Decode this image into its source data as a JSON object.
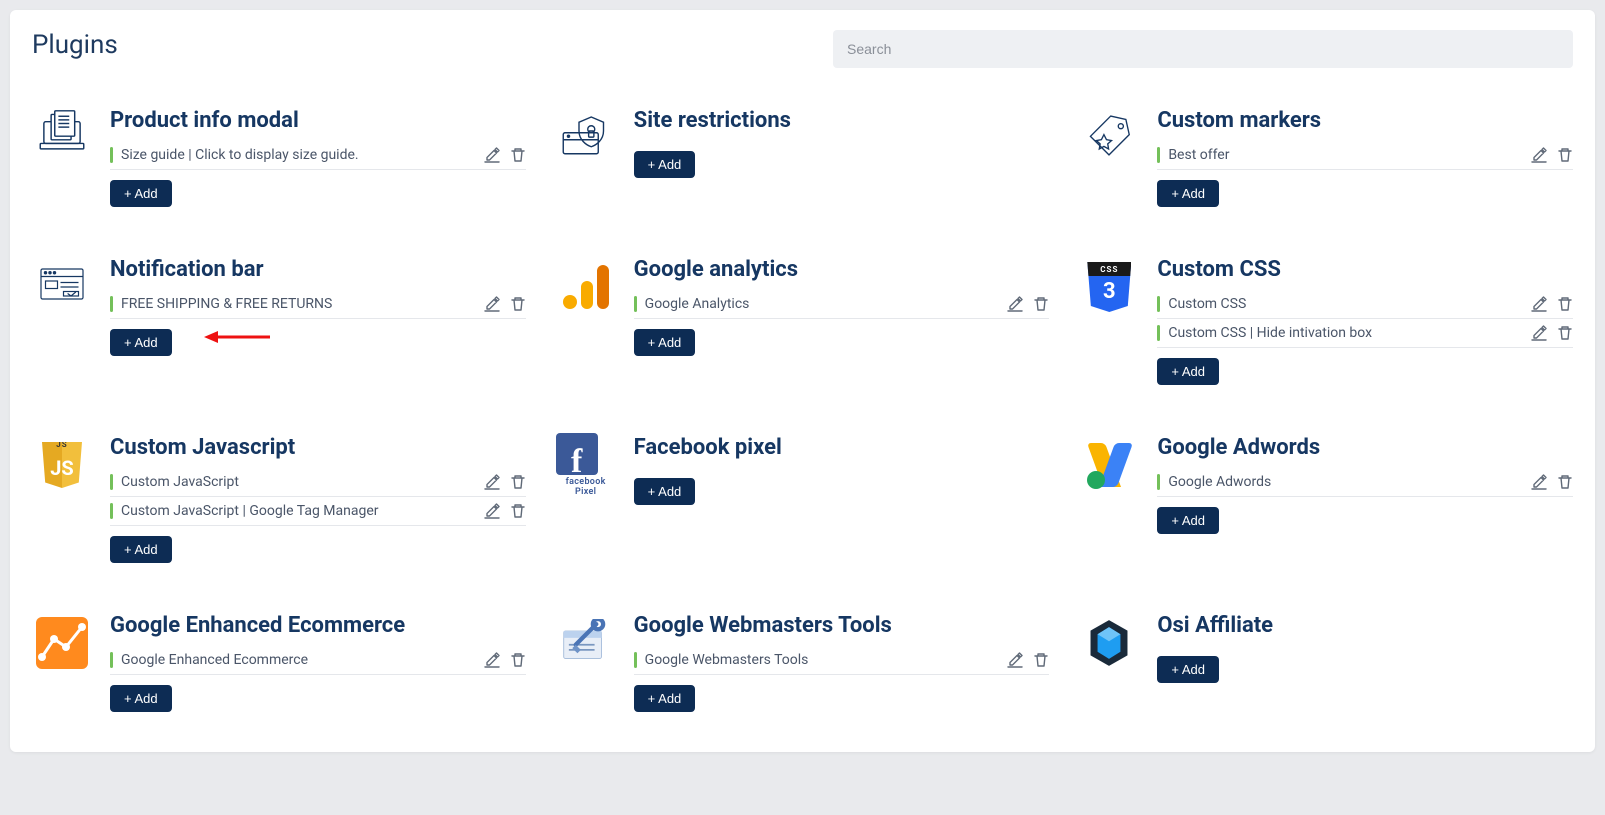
{
  "page": {
    "title": "Plugins"
  },
  "search": {
    "placeholder": "Search"
  },
  "add_label": "+ Add",
  "plugins": [
    {
      "key": "product-info-modal",
      "title": "Product info modal",
      "icon": "laptop-docs",
      "items": [
        {
          "label": "Size guide | Click to display size guide."
        }
      ],
      "show_arrow": false
    },
    {
      "key": "site-restrictions",
      "title": "Site restrictions",
      "icon": "shield-lock",
      "items": [],
      "show_arrow": false
    },
    {
      "key": "custom-markers",
      "title": "Custom markers",
      "icon": "tag-star",
      "items": [
        {
          "label": "Best offer"
        }
      ],
      "show_arrow": false
    },
    {
      "key": "notification-bar",
      "title": "Notification bar",
      "icon": "browser-bar",
      "items": [
        {
          "label": "FREE SHIPPING & FREE RETURNS"
        }
      ],
      "show_arrow": true
    },
    {
      "key": "google-analytics",
      "title": "Google analytics",
      "icon": "ga",
      "items": [
        {
          "label": "Google Analytics"
        }
      ],
      "show_arrow": false
    },
    {
      "key": "custom-css",
      "title": "Custom CSS",
      "icon": "css",
      "items": [
        {
          "label": "Custom CSS"
        },
        {
          "label": "Custom CSS | Hide intivation box"
        }
      ],
      "show_arrow": false
    },
    {
      "key": "custom-javascript",
      "title": "Custom Javascript",
      "icon": "js",
      "items": [
        {
          "label": "Custom JavaScript"
        },
        {
          "label": "Custom JavaScript | Google Tag Manager"
        }
      ],
      "show_arrow": false
    },
    {
      "key": "facebook-pixel",
      "title": "Facebook pixel",
      "icon": "fb",
      "items": [],
      "show_arrow": false,
      "sub": "facebook Pixel"
    },
    {
      "key": "google-adwords",
      "title": "Google Adwords",
      "icon": "adwords",
      "items": [
        {
          "label": "Google Adwords"
        }
      ],
      "show_arrow": false
    },
    {
      "key": "google-enhanced-ecommerce",
      "title": "Google Enhanced Ecommerce",
      "icon": "ge",
      "items": [
        {
          "label": "Google Enhanced Ecommerce"
        }
      ],
      "show_arrow": false
    },
    {
      "key": "google-webmasters-tools",
      "title": "Google Webmasters Tools",
      "icon": "wt",
      "items": [
        {
          "label": "Google Webmasters Tools"
        }
      ],
      "show_arrow": false
    },
    {
      "key": "osi-affiliate",
      "title": "Osi Affiliate",
      "icon": "osi",
      "items": [],
      "show_arrow": false
    }
  ],
  "css_label": "CSS"
}
